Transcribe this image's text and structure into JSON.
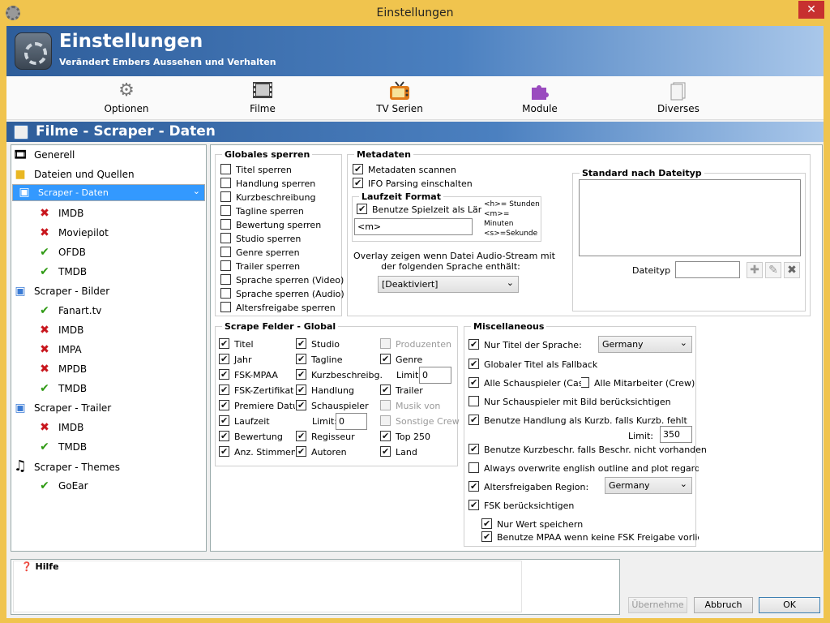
{
  "window": {
    "title": "Einstellungen",
    "close_glyph": "✕"
  },
  "header": {
    "title": "Einstellungen",
    "subtitle": "Verändert Embers Aussehen und Verhalten"
  },
  "toolbar": [
    {
      "label": "Optionen",
      "icon": "gear-icon"
    },
    {
      "label": "Filme",
      "icon": "film-icon"
    },
    {
      "label": "TV Serien",
      "icon": "tv-icon"
    },
    {
      "label": "Module",
      "icon": "puzzle-icon"
    },
    {
      "label": "Diverses",
      "icon": "document-icon"
    }
  ],
  "section": {
    "title": "Filme - Scraper - Daten"
  },
  "tree": [
    {
      "label": "Generell",
      "icon": "film-icon"
    },
    {
      "label": "Dateien und Quellen",
      "icon": "folder-icon"
    },
    {
      "label": "Scraper - Daten",
      "icon": "data-icon",
      "selected": true
    },
    {
      "label": "IMDB",
      "status": "disabled"
    },
    {
      "label": "Moviepilot",
      "status": "disabled"
    },
    {
      "label": "OFDB",
      "status": "enabled"
    },
    {
      "label": "TMDB",
      "status": "enabled"
    },
    {
      "label": "Scraper - Bilder",
      "icon": "image-icon"
    },
    {
      "label": "Fanart.tv",
      "status": "enabled"
    },
    {
      "label": "IMDB",
      "status": "disabled"
    },
    {
      "label": "IMPA",
      "status": "disabled"
    },
    {
      "label": "MPDB",
      "status": "disabled"
    },
    {
      "label": "TMDB",
      "status": "enabled"
    },
    {
      "label": "Scraper - Trailer",
      "icon": "trailer-icon"
    },
    {
      "label": "IMDB",
      "status": "disabled"
    },
    {
      "label": "TMDB",
      "status": "enabled"
    },
    {
      "label": "Scraper - Themes",
      "icon": "music-icon"
    },
    {
      "label": "GoEar",
      "status": "enabled"
    }
  ],
  "global_lock": {
    "title": "Globales sperren",
    "items": [
      "Titel sperren",
      "Handlung sperren",
      "Kurzbeschreibung",
      "Tagline sperren",
      "Bewertung sperren",
      "Studio sperren",
      "Genre sperren",
      "Trailer sperren",
      "Sprache sperren (Video)",
      "Sprache sperren (Audio)",
      "Altersfreigabe sperren"
    ]
  },
  "metadata": {
    "title": "Metadaten",
    "scan": "Metadaten scannen",
    "ifo": "IFO Parsing einschalten",
    "runtime_title": "Laufzeit Format",
    "runtime_use": "Benutze Spielzeit als Länge",
    "runtime_value": "<m>",
    "runtime_help": [
      "<h>= Stunden",
      "<m>=",
      "Minuten",
      "<s>=Sekunde"
    ],
    "overlay_text": [
      "Overlay zeigen wenn Datei Audio-Stream mit",
      "der folgenden Sprache enthält:"
    ],
    "overlay_value": "[Deaktiviert]",
    "filetype_title": "Standard nach Dateityp",
    "filetype_label": "Dateityp",
    "filetype_value": ""
  },
  "scrape_fields": {
    "title": "Scrape Felder - Global",
    "col1": [
      {
        "label": "Titel",
        "checked": true
      },
      {
        "label": "Jahr",
        "checked": true
      },
      {
        "label": "FSK-MPAA",
        "checked": true
      },
      {
        "label": "FSK-Zertifikat",
        "checked": true
      },
      {
        "label": "Premiere Datum",
        "checked": true
      },
      {
        "label": "Laufzeit",
        "checked": true
      },
      {
        "label": "Bewertung",
        "checked": true
      },
      {
        "label": "Anz. Stimmen",
        "checked": true
      }
    ],
    "col2": [
      {
        "label": "Studio",
        "checked": true
      },
      {
        "label": "Tagline",
        "checked": true
      },
      {
        "label": "Kurzbeschreibg.",
        "checked": true
      },
      {
        "label": "Handlung",
        "checked": true
      },
      {
        "label": "Schauspieler",
        "checked": true
      },
      {
        "label": "Regisseur",
        "checked": true
      },
      {
        "label": "Autoren",
        "checked": true
      }
    ],
    "col2_limit_label": "Limit:",
    "col2_limit_value": "0",
    "col3": [
      {
        "label": "Produzenten",
        "checked": false,
        "disabled": true
      },
      {
        "label": "Genre",
        "checked": true
      },
      {
        "label": "Trailer",
        "checked": true
      },
      {
        "label": "Musik von",
        "checked": false,
        "disabled": true
      },
      {
        "label": "Sonstige Crew",
        "checked": false,
        "disabled": true
      },
      {
        "label": "Top 250",
        "checked": true
      },
      {
        "label": "Land",
        "checked": true
      }
    ],
    "col3_limit_label": "Limit:",
    "col3_limit_value": "0"
  },
  "misc": {
    "title": "Miscellaneous",
    "title_lang": "Nur Titel der Sprache:",
    "title_lang_value": "Germany",
    "global_title": "Globaler Titel als Fallback",
    "all_actors": "Alle Schauspieler (Cast)",
    "all_crew": "Alle Mitarbeiter (Crew)",
    "actors_img": "Nur Schauspieler mit Bild berücksichtigen",
    "outline_plot": "Benutze Handlung als Kurzb. falls Kurzb. fehlt",
    "limit_label": "Limit:",
    "limit_value": "350",
    "plot_outline": "Benutze Kurzbeschr. falls Beschr. nicht vorhanden",
    "overwrite": "Always overwrite english outline and plot regardless",
    "cert_region": "Altersfreigaben Region:",
    "cert_region_value": "Germany",
    "fsk": "FSK berücksichtigen",
    "only_value": "Nur Wert speichern",
    "use_mpaa": "Benutze MPAA wenn keine FSK Freigabe vorliegt"
  },
  "help": {
    "title": "Hilfe"
  },
  "buttons": {
    "apply": "Übernehme",
    "cancel": "Abbruch",
    "ok": "OK"
  }
}
